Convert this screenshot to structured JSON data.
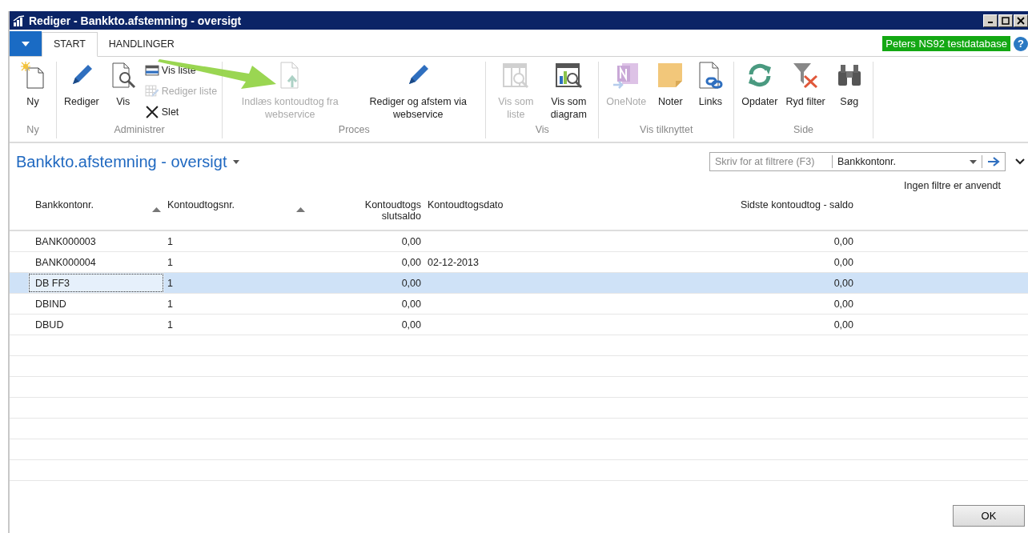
{
  "window": {
    "title": "Rediger - Bankkto.afstemning - oversigt"
  },
  "tabs": [
    {
      "label": "START",
      "selected": true
    },
    {
      "label": "HANDLINGER",
      "selected": false
    }
  ],
  "database_badge": "Peters NS92 testdatabase",
  "help": "?",
  "ribbon_groups": [
    {
      "label": "Ny",
      "items": [
        {
          "kind": "large",
          "label": "Ny",
          "disabled": false
        }
      ]
    },
    {
      "label": "Administrer",
      "items": [
        {
          "kind": "large",
          "label": "Rediger",
          "disabled": false
        },
        {
          "kind": "large",
          "label": "Vis",
          "disabled": false
        },
        {
          "kind": "small",
          "label": "Vis liste",
          "disabled": false
        },
        {
          "kind": "small",
          "label": "Rediger liste",
          "disabled": true
        },
        {
          "kind": "small",
          "label": "Slet",
          "disabled": false
        }
      ]
    },
    {
      "label": "Proces",
      "items": [
        {
          "kind": "large",
          "label": "Indlæs kontoudtog fra webservice",
          "disabled": true
        },
        {
          "kind": "large",
          "label": "Rediger og afstem via webservice",
          "disabled": false
        }
      ]
    },
    {
      "label": "Vis",
      "items": [
        {
          "kind": "large",
          "label": "Vis som liste",
          "disabled": true
        },
        {
          "kind": "large",
          "label": "Vis som diagram",
          "disabled": false
        }
      ]
    },
    {
      "label": "Vis tilknyttet",
      "items": [
        {
          "kind": "large",
          "label": "OneNote",
          "disabled": true
        },
        {
          "kind": "large",
          "label": "Noter",
          "disabled": false
        },
        {
          "kind": "large",
          "label": "Links",
          "disabled": false
        }
      ]
    },
    {
      "label": "Side",
      "items": [
        {
          "kind": "large",
          "label": "Opdater",
          "disabled": false
        },
        {
          "kind": "large",
          "label": "Ryd filter",
          "disabled": false
        },
        {
          "kind": "large",
          "label": "Søg",
          "disabled": false
        }
      ]
    }
  ],
  "page_title": "Bankkto.afstemning - oversigt",
  "filter": {
    "placeholder": "Skriv for at filtrere (F3)",
    "field": "Bankkontonr."
  },
  "filter_status": "Ingen filtre er anvendt",
  "table": {
    "columns": [
      {
        "label": "Bankkontonr.",
        "sorted": true
      },
      {
        "label": "Kontoudtogsnr.",
        "sorted": true
      },
      {
        "label": "Kontoudtogs slutsaldo",
        "sorted": false
      },
      {
        "label": "Kontoudtogsdato",
        "sorted": false
      },
      {
        "label": "Sidste kontoudtog - saldo",
        "sorted": false
      }
    ],
    "rows": [
      {
        "cells": [
          "BANK000003",
          "1",
          "0,00",
          "",
          "0,00"
        ],
        "selected": false
      },
      {
        "cells": [
          "BANK000004",
          "1",
          "0,00",
          "02-12-2013",
          "0,00"
        ],
        "selected": false
      },
      {
        "cells": [
          "DB FF3",
          "1",
          "0,00",
          "",
          "0,00"
        ],
        "selected": true
      },
      {
        "cells": [
          "DBIND",
          "1",
          "0,00",
          "",
          "0,00"
        ],
        "selected": false
      },
      {
        "cells": [
          "DBUD",
          "1",
          "0,00",
          "",
          "0,00"
        ],
        "selected": false
      }
    ]
  },
  "buttons": [
    "OK"
  ]
}
